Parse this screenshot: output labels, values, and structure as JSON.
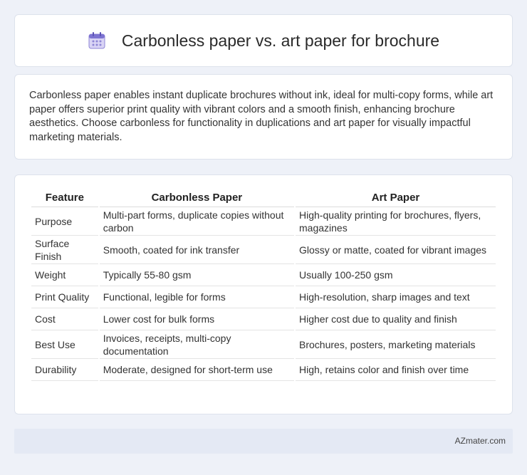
{
  "header": {
    "title": "Carbonless paper vs. art paper for brochure",
    "icon": "calendar-icon"
  },
  "summary": {
    "text": "Carbonless paper enables instant duplicate brochures without ink, ideal for multi-copy forms, while art paper offers superior print quality with vibrant colors and a smooth finish, enhancing brochure aesthetics. Choose carbonless for functionality in duplications and art paper for visually impactful marketing materials."
  },
  "table": {
    "columns": [
      "Feature",
      "Carbonless Paper",
      "Art Paper"
    ],
    "rows": [
      [
        "Purpose",
        "Multi-part forms, duplicate copies without carbon",
        "High-quality printing for brochures, flyers, magazines"
      ],
      [
        "Surface Finish",
        "Smooth, coated for ink transfer",
        "Glossy or matte, coated for vibrant images"
      ],
      [
        "Weight",
        "Typically 55-80 gsm",
        "Usually 100-250 gsm"
      ],
      [
        "Print Quality",
        "Functional, legible for forms",
        "High-resolution, sharp images and text"
      ],
      [
        "Cost",
        "Lower cost for bulk forms",
        "Higher cost due to quality and finish"
      ],
      [
        "Best Use",
        "Invoices, receipts, multi-copy documentation",
        "Brochures, posters, marketing materials"
      ],
      [
        "Durability",
        "Moderate, designed for short-term use",
        "High, retains color and finish over time"
      ]
    ]
  },
  "footer": {
    "brand": "AZmater.com"
  }
}
